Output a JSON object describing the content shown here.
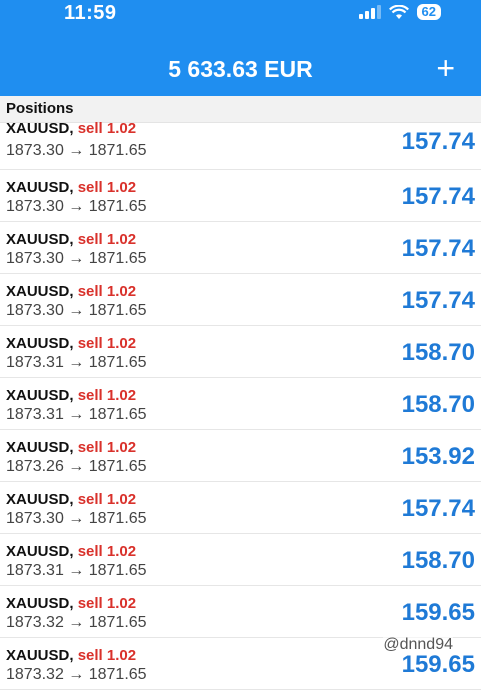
{
  "status_bar": {
    "time": "11:59",
    "battery": "62"
  },
  "header": {
    "balance": "5 633.63 EUR",
    "add_label": "+"
  },
  "section": {
    "title": "Positions"
  },
  "positions": [
    {
      "symbol": "XAUUSD,",
      "side": "sell 1.02",
      "prices": "1873.30 → 1871.65",
      "profit": "157.74"
    },
    {
      "symbol": "XAUUSD,",
      "side": "sell 1.02",
      "prices": "1873.30 → 1871.65",
      "profit": "157.74"
    },
    {
      "symbol": "XAUUSD,",
      "side": "sell 1.02",
      "prices": "1873.30 → 1871.65",
      "profit": "157.74"
    },
    {
      "symbol": "XAUUSD,",
      "side": "sell 1.02",
      "prices": "1873.30 → 1871.65",
      "profit": "157.74"
    },
    {
      "symbol": "XAUUSD,",
      "side": "sell 1.02",
      "prices": "1873.31 → 1871.65",
      "profit": "158.70"
    },
    {
      "symbol": "XAUUSD,",
      "side": "sell 1.02",
      "prices": "1873.31 → 1871.65",
      "profit": "158.70"
    },
    {
      "symbol": "XAUUSD,",
      "side": "sell 1.02",
      "prices": "1873.26 → 1871.65",
      "profit": "153.92"
    },
    {
      "symbol": "XAUUSD,",
      "side": "sell 1.02",
      "prices": "1873.30 → 1871.65",
      "profit": "157.74"
    },
    {
      "symbol": "XAUUSD,",
      "side": "sell 1.02",
      "prices": "1873.31 → 1871.65",
      "profit": "158.70"
    },
    {
      "symbol": "XAUUSD,",
      "side": "sell 1.02",
      "prices": "1873.32 → 1871.65",
      "profit": "159.65"
    },
    {
      "symbol": "XAUUSD,",
      "side": "sell 1.02",
      "prices": "1873.32 → 1871.65",
      "profit": "159.65"
    }
  ],
  "watermark": "@dnnd94",
  "colors": {
    "accent": "#1f8ef0",
    "sell": "#d9312b",
    "profit": "#1f7ad6"
  }
}
